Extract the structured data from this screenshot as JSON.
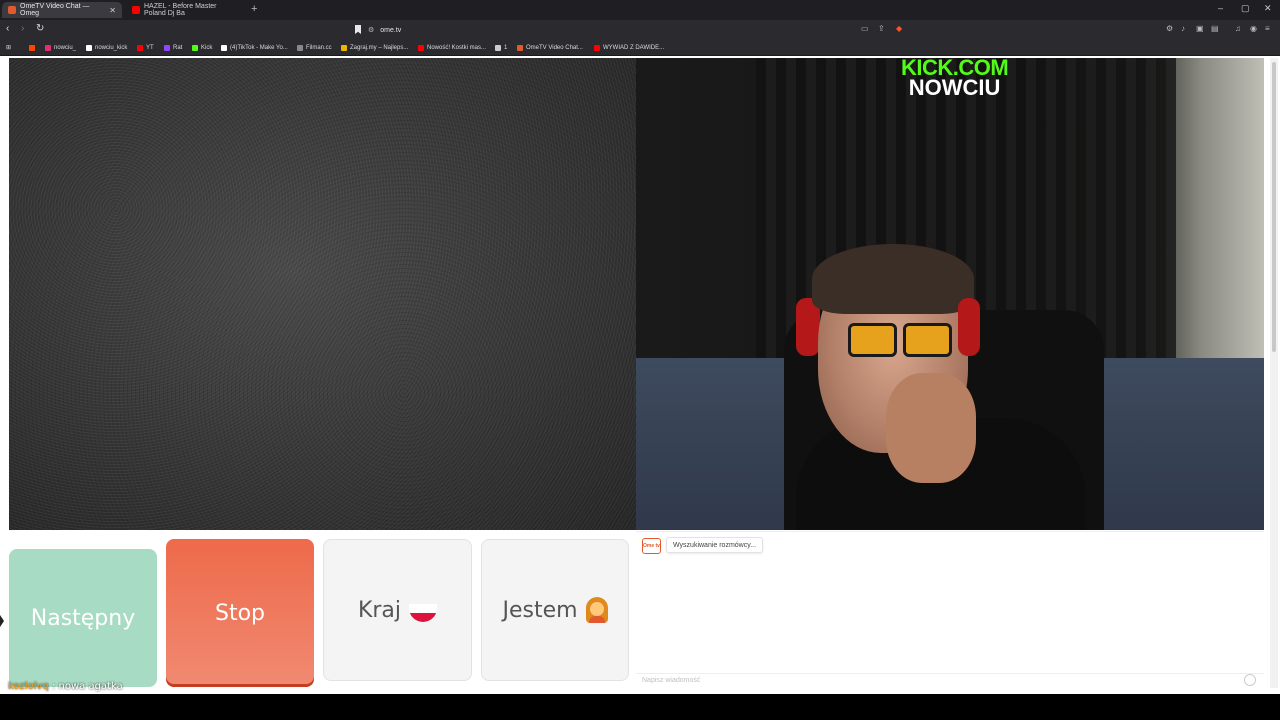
{
  "browser": {
    "tabs": [
      {
        "title": "OmeTV Video Chat — Omeg",
        "active": true,
        "favicon_color": "#e05a2e"
      },
      {
        "title": "HAZEL - Before Master Poland Dj Ba",
        "active": false,
        "favicon_color": "#ff0000"
      }
    ],
    "new_tab_label": "+",
    "url": "ome.tv",
    "window_controls": {
      "minimize": "–",
      "maximize": "▢",
      "close": "✕"
    },
    "nav": {
      "back": "‹",
      "forward": "›",
      "reload": "↻"
    },
    "bookmarks": [
      {
        "label": "",
        "color": "#ff4500"
      },
      {
        "label": "nowciu_",
        "color": "#e1306c"
      },
      {
        "label": "nowciu_kick",
        "color": "#ffffff"
      },
      {
        "label": "YT",
        "color": "#ff0000"
      },
      {
        "label": "Rat",
        "color": "#9146ff"
      },
      {
        "label": "Kick",
        "color": "#53fc18"
      },
      {
        "label": "(4)TikTok - Make Yo...",
        "color": "#ffffff"
      },
      {
        "label": "Filman.cc",
        "color": "#888888"
      },
      {
        "label": "Zagraj.my – Najleps...",
        "color": "#f0b400"
      },
      {
        "label": "Nowość! Kostki mas...",
        "color": "#ff0000"
      },
      {
        "label": "1",
        "color": "#cccccc"
      },
      {
        "label": "OmeTV Video Chat...",
        "color": "#e05a2e"
      },
      {
        "label": "WYWIAD Z DAWIDE...",
        "color": "#ff0000"
      }
    ]
  },
  "stream_overlay": {
    "line1": "KICK.COM",
    "line2": "NOWCIU"
  },
  "controls": {
    "next_label": "Następny",
    "stop_label": "Stop",
    "country_label": "Kraj",
    "gender_label": "Jestem"
  },
  "chat": {
    "logo_text": "Ome tv",
    "status_message": "Wyszukiwanie rozmówcy...",
    "input_placeholder": "Napisz wiadomość"
  },
  "overlay_caption": {
    "username": "kozlolvq",
    "message": "nowa agatka"
  }
}
